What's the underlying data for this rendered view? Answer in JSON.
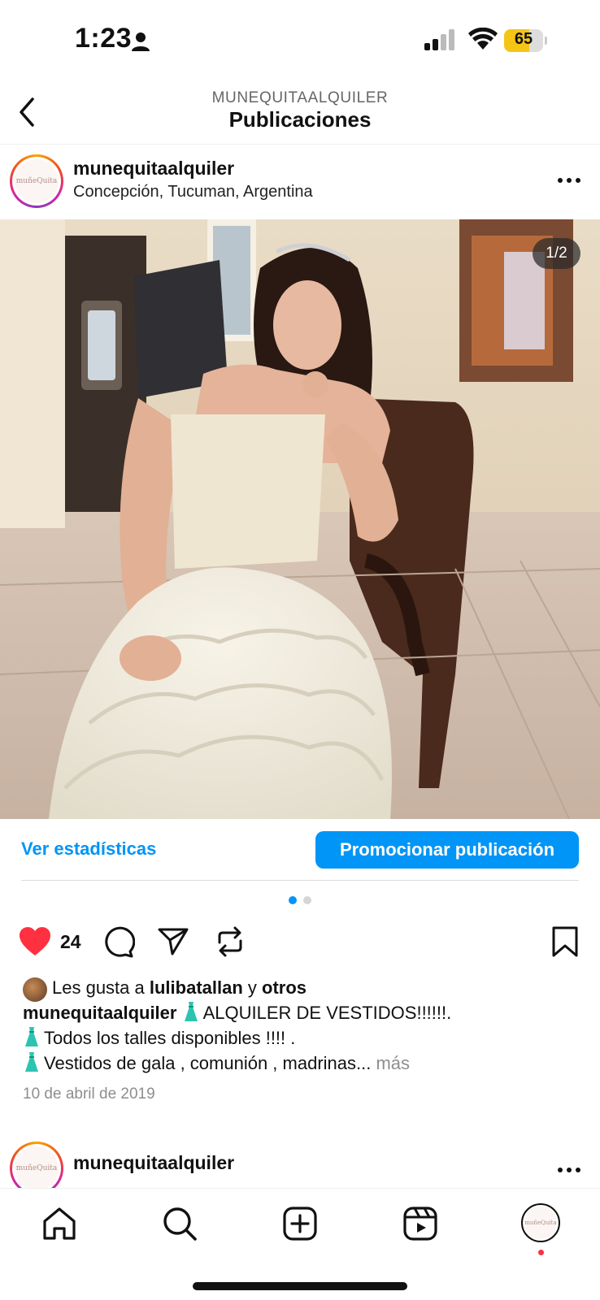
{
  "status_bar": {
    "time": "1:23",
    "battery_percent": "65",
    "battery_level": 0.65,
    "icons": [
      "person-icon",
      "cellular-signal-icon",
      "wifi-icon",
      "battery-icon"
    ]
  },
  "header": {
    "account": "MUNEQUITAALQUILER",
    "title": "Publicaciones",
    "back_icon": "chevron-left-icon"
  },
  "post": {
    "username": "munequitaalquiler",
    "location": "Concepción, Tucuman, Argentina",
    "avatar_text": "muñeQuita",
    "more_icon": "more-horizontal-icon",
    "media_counter": "1/2",
    "carousel": {
      "total": 2,
      "active": 1
    },
    "insights": {
      "stats_label": "Ver estadísticas",
      "promote_label": "Promocionar publicación"
    },
    "actions": {
      "like_count": "24",
      "liked": true,
      "icons": [
        "heart-icon",
        "comment-icon",
        "share-icon",
        "repost-icon",
        "bookmark-icon"
      ]
    },
    "likes_line": {
      "prefix": "Les gusta a",
      "user": "lulibatallan",
      "connector": "y",
      "others": "otros"
    },
    "caption": {
      "username": "munequitaalquiler",
      "line1": "ALQUILER DE VESTIDOS!!!!!!.",
      "line2": "Todos los talles disponibles !!!! .",
      "line3": "Vestidos de gala , comunión , madrinas...",
      "more": "más"
    },
    "date": "10 de abril de 2019"
  },
  "next_post": {
    "username": "munequitaalquiler",
    "avatar_text": "muñeQuita"
  },
  "tab_bar": {
    "items": [
      "home-icon",
      "search-icon",
      "create-icon",
      "reels-icon",
      "profile-avatar"
    ],
    "profile_avatar_text": "muñeQuita"
  },
  "colors": {
    "accent": "#0095f6",
    "like": "#ff3040",
    "muted": "#8e8e8e",
    "battery": "#f5c516"
  }
}
